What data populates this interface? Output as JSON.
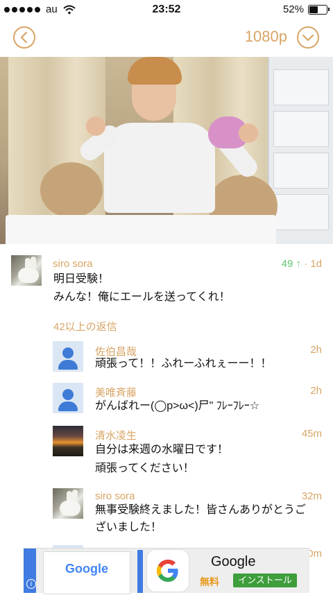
{
  "status_bar": {
    "carrier": "au",
    "time": "23:52",
    "battery": "52%",
    "battery_level": 0.52
  },
  "nav": {
    "quality": "1080p",
    "back_icon": "chevron-left-icon",
    "menu_icon": "chevron-down-icon"
  },
  "video": {
    "description_icon": "video-frame"
  },
  "comment": {
    "author": "siro sora",
    "score": "49",
    "age": "1d",
    "lines": [
      "明日受験！",
      "みんな！俺にエールを送ってくれ！"
    ],
    "replies_label": "42以上の返信"
  },
  "replies": [
    {
      "author": "佐伯昌哉",
      "age": "2h",
      "lines": [
        "頑張って！！ふれーふれぇーー！！"
      ]
    },
    {
      "author": "美唯斉藤",
      "age": "2h",
      "lines": [
        "がんばれー(◯p>ω<)尸\" ﾌﾚｰﾌﾚｰ☆"
      ]
    },
    {
      "author": "清水凌生",
      "age": "45m",
      "lines": [
        "自分は来週の水曜日です！",
        "頑張ってください！"
      ]
    },
    {
      "author": "siro sora",
      "age": "32m",
      "lines": [
        "無事受験終えました！皆さんありがとうご",
        "ざいました！"
      ]
    }
  ],
  "partial_reply_age": "0m",
  "ad": {
    "card_logo": "Google",
    "title": "Google",
    "free_label": "無料",
    "install_label": "インストール",
    "info_label": "i"
  },
  "colors": {
    "accent": "#d8a565",
    "score_green": "#5fc56a",
    "install_green": "#3d9e3b"
  }
}
